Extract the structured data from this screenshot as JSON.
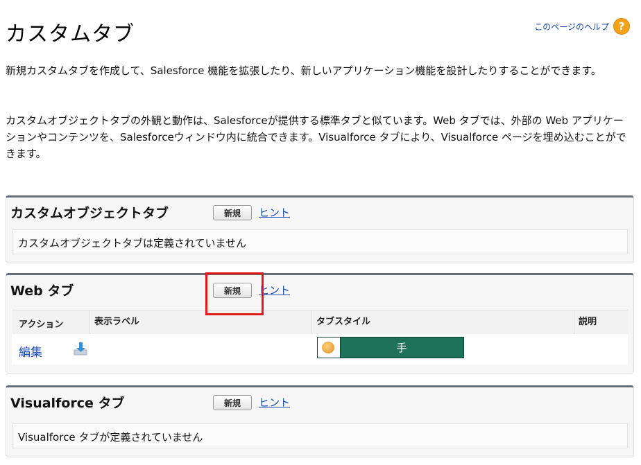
{
  "page": {
    "title": "カスタムタブ",
    "help_link": "このページのヘルプ",
    "help_icon": "help-icon"
  },
  "descriptions": [
    "新規カスタムタブを作成して、Salesforce 機能を拡張したり、新しいアプリケーション機能を設計したりすることができます。",
    "カスタムオブジェクトタブの外観と動作は、Salesforceが提供する標準タブと似ています。Web タブでは、外部の Web アプリケーションやコンテンツを、Salesforceウィンドウ内に統合できます。Visualforce タブにより、Visualforce ページを埋め込むことができます。"
  ],
  "sections": {
    "custom_object": {
      "title": "カスタムオブジェクトタブ",
      "new_button": "新規",
      "hint_link": "ヒント",
      "empty_message": "カスタムオブジェクトタブは定義されていません"
    },
    "web": {
      "title": "Web タブ",
      "new_button": "新規",
      "hint_link": "ヒント",
      "columns": [
        "アクション",
        "表示ラベル",
        "タブスタイル",
        "説明"
      ],
      "rows": [
        {
          "action": "編集",
          "action_icon": "download-icon",
          "label": "",
          "tab_style_text": "手",
          "tab_style_color": "#1e7259",
          "description": ""
        }
      ]
    },
    "visualforce": {
      "title": "Visualforce タブ",
      "new_button": "新規",
      "hint_link": "ヒント",
      "empty_message": "Visualforce タブが定義されていません"
    }
  },
  "colors": {
    "link": "#1a4db3",
    "panel_top_border": "#666e7a",
    "highlight": "#e21a1a"
  }
}
